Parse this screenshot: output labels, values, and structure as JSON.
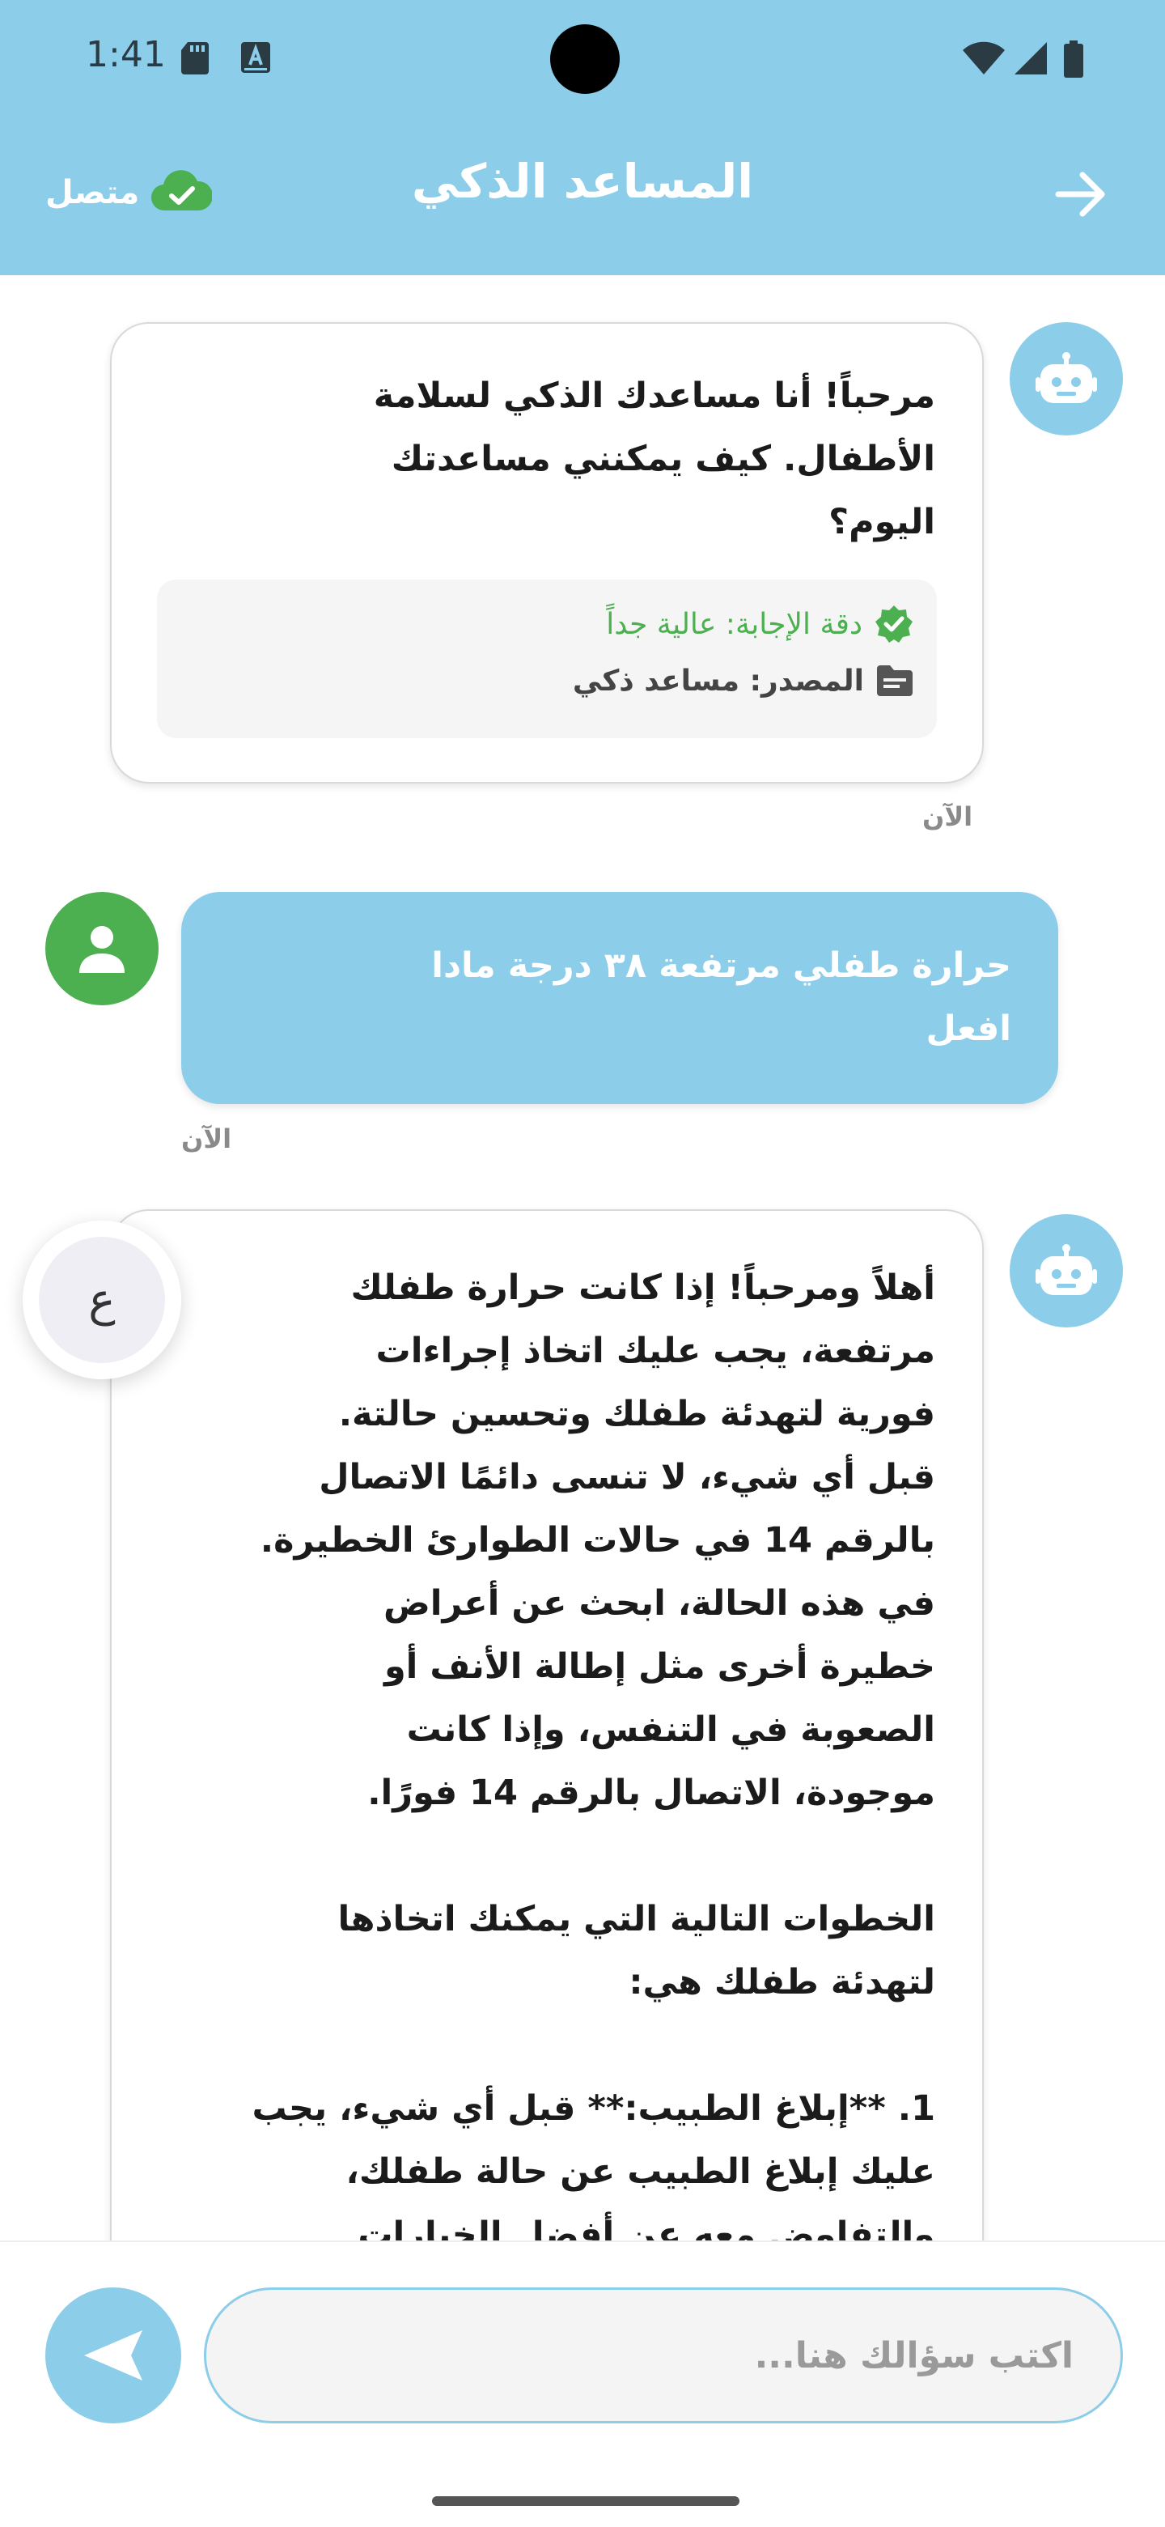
{
  "status_bar": {
    "time": "1:41"
  },
  "app_bar": {
    "title": "المساعد الذكي",
    "connection_status": "متصل"
  },
  "messages": [
    {
      "sender": "bot",
      "text": "مرحباً! أنا مساعدك الذكي لسلامة\nالأطفال. كيف يمكنني مساعدتك\nاليوم؟",
      "accuracy": "دقة الإجابة: عالية جداً",
      "source": "المصدر: مساعد ذكي",
      "time": "الآن"
    },
    {
      "sender": "user",
      "text": "حرارة طفلي مرتفعة ٣٨ درجة مادا\nافعل",
      "time": "الآن"
    },
    {
      "sender": "bot",
      "text": "أهلاً ومرحباً! إذا كانت حرارة طفلك\nمرتفعة، يجب عليك اتخاذ إجراءات\nفورية لتهدئة طفلك وتحسين حالتة.\nقبل أي شيء، لا تنسى دائمًا الاتصال\nبالرقم 14 في حالات الطوارئ الخطيرة.\nفي هذه الحالة، ابحث عن أعراض\nخطيرة أخرى مثل إطالة الأنف أو\nالصعوبة في التنفس، وإذا كانت\nموجودة، الاتصال بالرقم 14 فورًا.\n\nالخطوات التالية التي يمكنك اتخاذها\nلتهدئة طفلك هي:\n\n1. **إبلاغ الطبيب:** قبل أي شيء، يجب\nعليك إبلاغ الطبيب عن حالة طفلك،\nوالتفاوض معه عن أفضل الخيارات"
    }
  ],
  "language_toggle": {
    "label": "ع"
  },
  "composer": {
    "placeholder": "اكتب سؤالك هنا..."
  },
  "colors": {
    "primary": "#8ccdea",
    "user_avatar": "#4caf50",
    "accent_green": "#4caf50"
  }
}
